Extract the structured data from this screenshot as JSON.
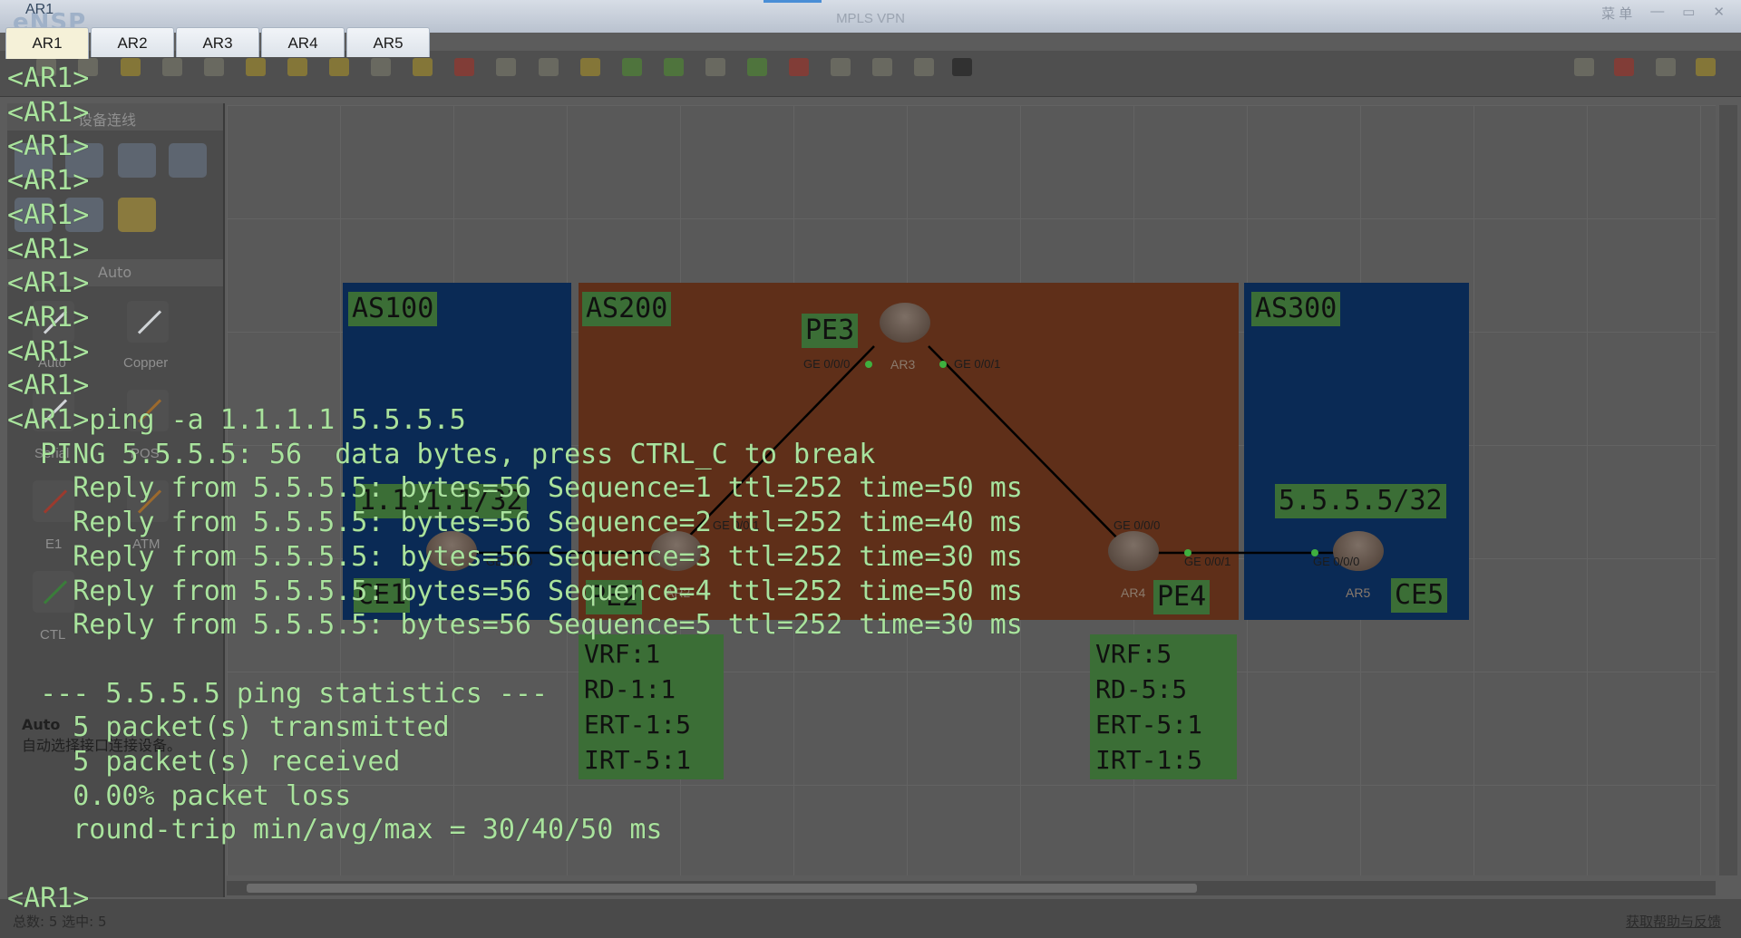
{
  "window": {
    "title": "MPLS VPN",
    "app_logo": "eNSP",
    "console_title": "AR1",
    "controls": [
      "菜 单",
      "—",
      "▭",
      "✕"
    ]
  },
  "tabs": [
    {
      "label": "AR1",
      "active": true
    },
    {
      "label": "AR2",
      "active": false
    },
    {
      "label": "AR3",
      "active": false
    },
    {
      "label": "AR4",
      "active": false
    },
    {
      "label": "AR5",
      "active": false
    }
  ],
  "console": {
    "lines": [
      "<AR1>",
      "<AR1>",
      "<AR1>",
      "<AR1>",
      "<AR1>",
      "<AR1>",
      "<AR1>",
      "<AR1>",
      "<AR1>",
      "<AR1>",
      "<AR1>ping -a 1.1.1.1 5.5.5.5",
      "  PING 5.5.5.5: 56  data bytes, press CTRL_C to break",
      "    Reply from 5.5.5.5: bytes=56 Sequence=1 ttl=252 time=50 ms",
      "    Reply from 5.5.5.5: bytes=56 Sequence=2 ttl=252 time=40 ms",
      "    Reply from 5.5.5.5: bytes=56 Sequence=3 ttl=252 time=30 ms",
      "    Reply from 5.5.5.5: bytes=56 Sequence=4 ttl=252 time=50 ms",
      "    Reply from 5.5.5.5: bytes=56 Sequence=5 ttl=252 time=30 ms",
      "",
      "  --- 5.5.5.5 ping statistics ---",
      "    5 packet(s) transmitted",
      "    5 packet(s) received",
      "    0.00% packet loss",
      "    round-trip min/avg/max = 30/40/50 ms",
      "",
      "<AR1>"
    ]
  },
  "left_panel": {
    "header_devices": "设备连线",
    "header_auto": "Auto",
    "cables": [
      "Auto",
      "Copper",
      "Serial",
      "POS",
      "E1",
      "ATM",
      "CTL"
    ],
    "desc_title": "Auto",
    "desc_text": "自动选择接口连接设备。"
  },
  "topology": {
    "as_labels": [
      "AS100",
      "AS200",
      "AS300"
    ],
    "node_labels": [
      "PE3",
      "PE2",
      "PE4",
      "CE1",
      "CE5"
    ],
    "prefixes": [
      "1.1.1.1/32",
      "5.5.5.5/32"
    ],
    "routers": [
      "AR1",
      "AR2",
      "AR3",
      "AR4",
      "AR5"
    ],
    "ports": [
      "GE 0/0/0",
      "GE 0/0/1",
      "GE 0/0/0",
      "GE 0/0/0",
      "GE 0/0/1",
      "GE 0/0/1",
      "GE 0/0/0",
      "GE 0/0/0"
    ],
    "vrf_pe2": [
      "VRF:1",
      "RD-1:1",
      "ERT-1:5",
      "IRT-5:1"
    ],
    "vrf_pe4": [
      "VRF:5",
      "RD-5:5",
      "ERT-5:1",
      "IRT-1:5"
    ]
  },
  "status": {
    "left": "总数: 5 选中: 5",
    "right": "获取帮助与反馈"
  },
  "colors": {
    "as_blue": "#0a2a55",
    "as_orange": "#5f2f19",
    "label_green": "#3b6e36",
    "console_text": "#a9e39d"
  }
}
